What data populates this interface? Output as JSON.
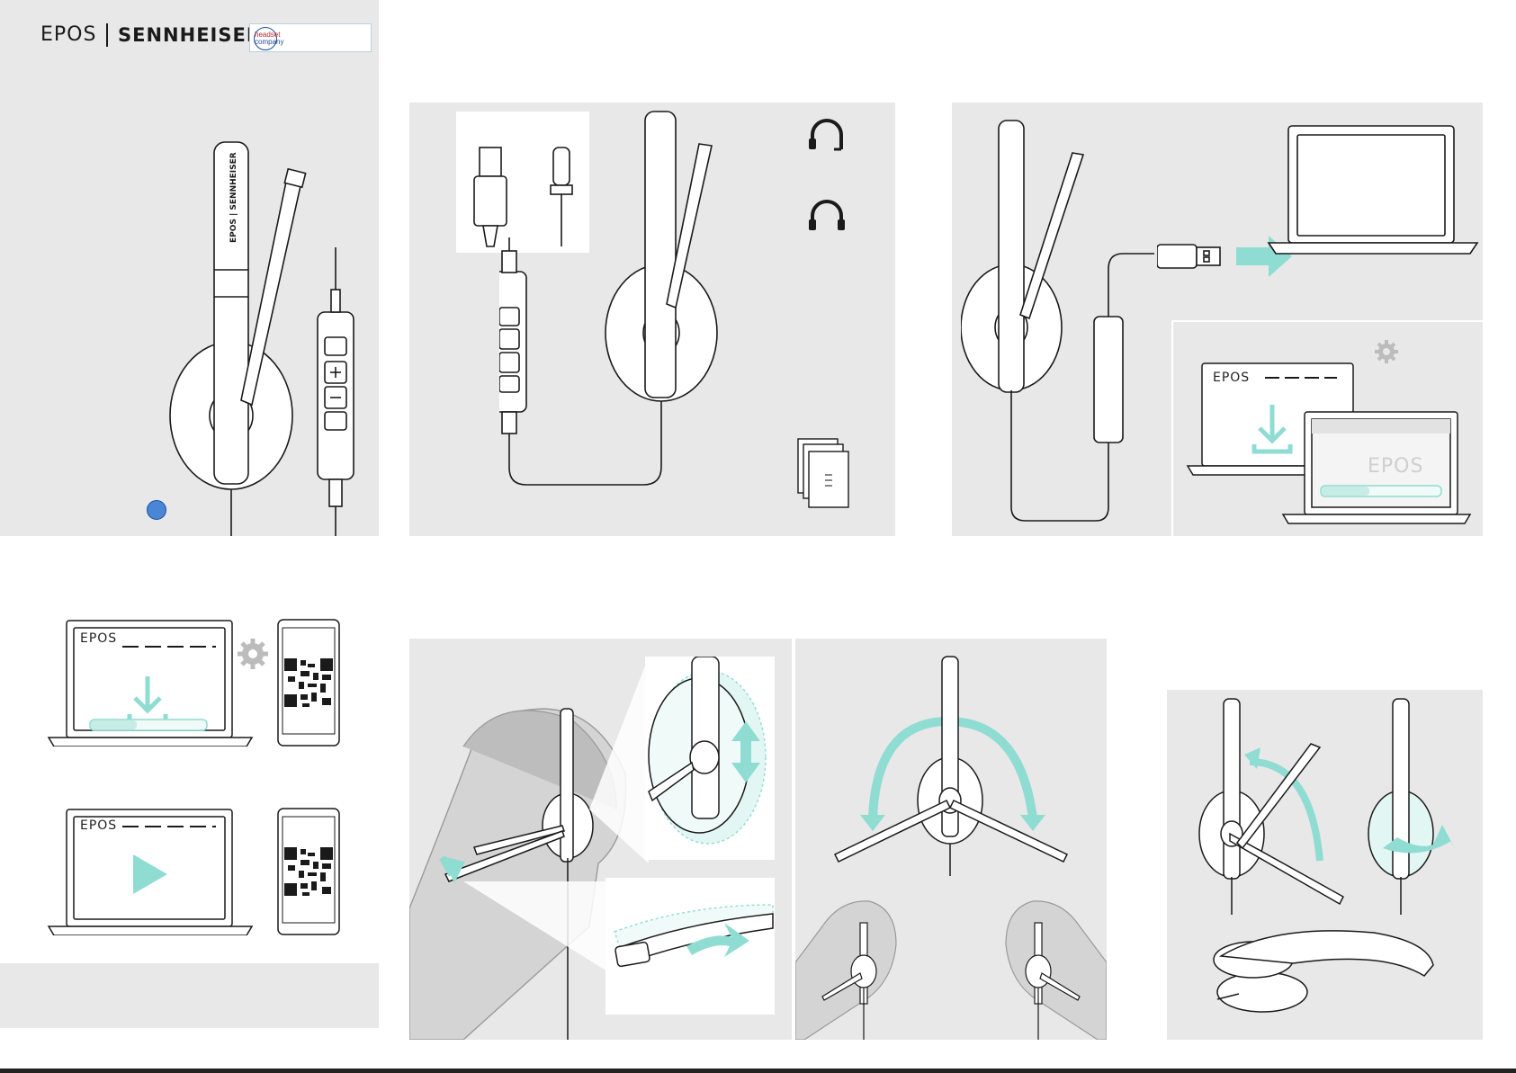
{
  "header": {
    "brand_epos": "EPOS",
    "brand_sennheiser": "SENNHEISER",
    "partner_badge_line1": "headset",
    "partner_badge_line2": "company"
  },
  "headset": {
    "boom_mark": "EPOS",
    "headband_text": "EPOS | SENNHEISER"
  },
  "software": {
    "screen_brand": "EPOS",
    "splash_brand": "EPOS",
    "download_progress": 0.4,
    "install_progress": 0.4
  },
  "colors": {
    "accent": "#8fdcd2",
    "panel": "#e8e8e8",
    "line": "#1a1a1a",
    "dot": "#4a86d6"
  },
  "icons": {
    "headset_mono": "headset-mono-icon",
    "headset_stereo": "headset-stereo-icon",
    "settings": "gear-icon",
    "download": "download-icon",
    "play": "play-icon",
    "qr": "qr-code-icon"
  }
}
